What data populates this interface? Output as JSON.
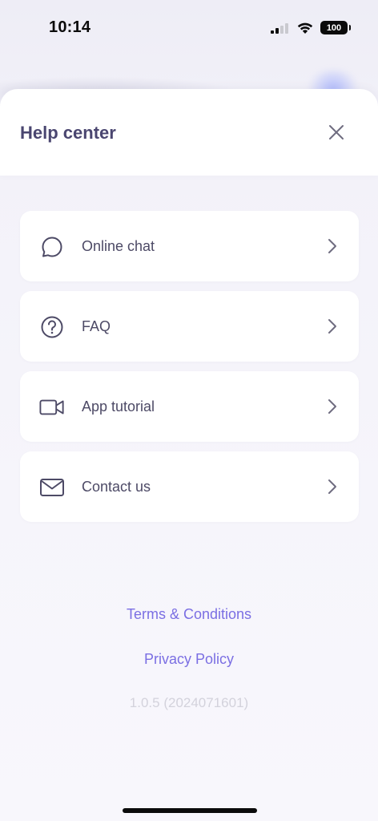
{
  "status_bar": {
    "time": "10:14",
    "battery": "100"
  },
  "header": {
    "title": "Help center",
    "close_icon": "close-icon"
  },
  "menu": {
    "items": [
      {
        "label": "Online chat",
        "icon": "chat-bubble-icon"
      },
      {
        "label": "FAQ",
        "icon": "question-circle-icon"
      },
      {
        "label": "App tutorial",
        "icon": "video-camera-icon"
      },
      {
        "label": "Contact us",
        "icon": "envelope-icon"
      }
    ]
  },
  "footer": {
    "terms": "Terms & Conditions",
    "privacy": "Privacy Policy",
    "version": "1.0.5 (2024071601)"
  },
  "colors": {
    "accent": "#7b6fe3",
    "title": "#4a4670",
    "icon": "#4d4a66"
  }
}
